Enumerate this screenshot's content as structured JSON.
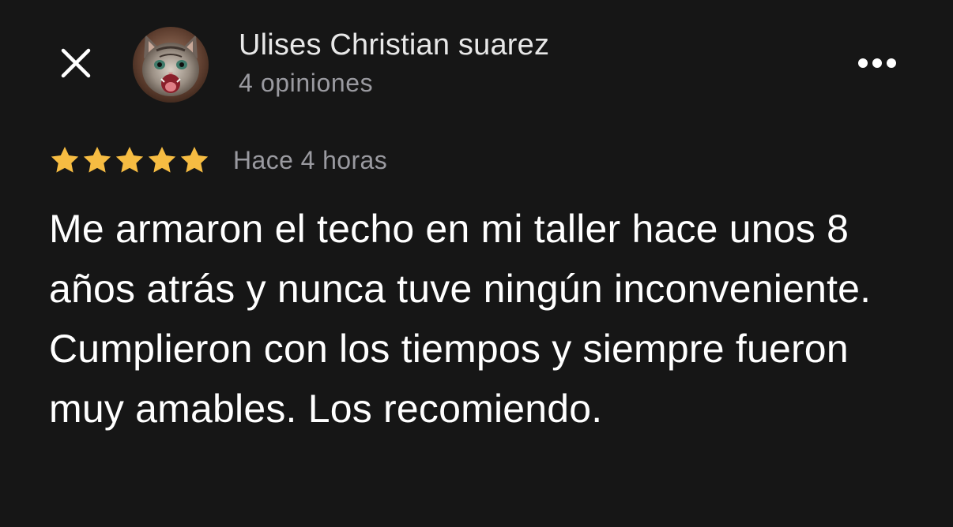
{
  "header": {
    "close_icon": "close-icon",
    "more_icon": "more-horizontal-icon",
    "reviewer": {
      "name": "Ulises Christian suarez",
      "review_count": "4 opiniones",
      "avatar": "kitten-avatar"
    }
  },
  "review": {
    "rating": 5,
    "max_rating": 5,
    "star_color": "#f6bc42",
    "time_ago": "Hace 4 horas",
    "text": "Me armaron el techo en mi taller hace unos 8 años atrás y nunca tuve ningún inconveniente. Cumplieron con los tiempos y siempre fueron muy amables. Los recomiendo."
  },
  "colors": {
    "background": "#161616",
    "primary_text": "#ffffff",
    "secondary_text": "#9a9aa0"
  }
}
